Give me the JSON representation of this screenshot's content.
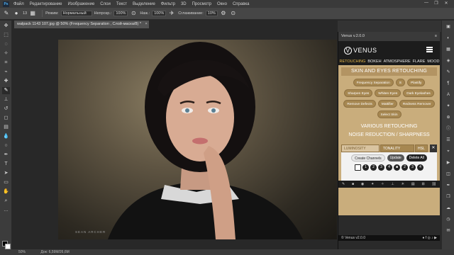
{
  "menubar": {
    "items": [
      "Файл",
      "Редактирование",
      "Изображение",
      "Слои",
      "Текст",
      "Выделение",
      "Фильтр",
      "3D",
      "Просмотр",
      "Окно",
      "Справка"
    ],
    "window_controls": [
      "—",
      "❐",
      "✕"
    ]
  },
  "optbar": {
    "brush_size": "13",
    "mode_label": "Режим:",
    "mode_value": "Нормальный",
    "opacity_label": "Непрозр.:",
    "opacity_value": "100%",
    "pressure_label": "Наж.:",
    "pressure_value": "100%",
    "smoothing_label": "Сглаживание:",
    "smoothing_value": "10%"
  },
  "document": {
    "tab_title": "walpack 1143 107.jpg @ 50% (Frequency Separation , Слой-маска/8) *",
    "close": "×",
    "watermark": "SEAN ARCHER"
  },
  "statusbar": {
    "zoom": "50%",
    "doc_size": "Док: 6,59M/26,6M"
  },
  "venus": {
    "header_title": "Venus v.2.0.0",
    "logo_text": "VENUS",
    "tabs": [
      "RETOUCHING",
      "BOKEH",
      "ATMOSPHERE",
      "FLARE",
      "MOOD"
    ],
    "active_tab": "RETOUCHING",
    "section_title": "SKIN AND EYES RETOUCHING",
    "rows": [
      [
        "Frequency Separation",
        "S",
        "Plastify"
      ],
      [
        "Sharpen Eyes",
        "Whiten Eyes",
        "Dark Eyelashes"
      ],
      [
        "Remove Defects",
        "Mattifier",
        "Redness Remover"
      ],
      [
        "Select Skin"
      ]
    ],
    "various": "VARIOUS RETOUCHING",
    "noise": "NOISE REDUCTION / SHARPNESS",
    "mask_tabs": [
      "LUMINOSITY MASKS",
      "TONALITY MASKS",
      "HSL"
    ],
    "mask_close": "✕",
    "create_channels": "Create Channels",
    "update": "Update",
    "delete_all": "Delete All",
    "numbers": [
      "1",
      "2",
      "3",
      "4",
      "■",
      "2",
      "3",
      "4"
    ],
    "footer": "© Venus v2.0.0"
  },
  "accent_color": "#c9ad7c"
}
